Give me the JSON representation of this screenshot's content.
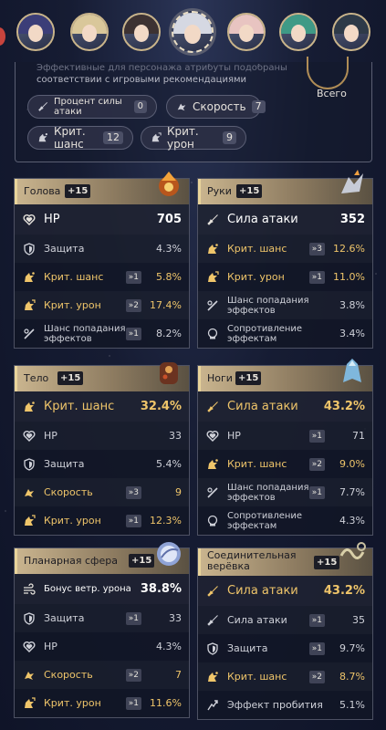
{
  "characters": [
    {
      "name": "char-1",
      "hair": "#3c3e78"
    },
    {
      "name": "char-2",
      "hair": "#d9c79a"
    },
    {
      "name": "char-3",
      "hair": "#3d3232"
    },
    {
      "name": "char-4",
      "hair": "#d5d8e2"
    },
    {
      "name": "char-5",
      "hair": "#e8c4c1"
    },
    {
      "name": "char-6",
      "hair": "#3f9a86"
    },
    {
      "name": "char-7",
      "hair": "#2e3a48"
    }
  ],
  "recommendation": {
    "line1": "Эффективные для персонажа атрибуты подобраны в",
    "line2": "соответствии с игровыми рекомендациями",
    "total_label": "Всего"
  },
  "filters": [
    {
      "label": "Процент силы атаки",
      "count": "0",
      "icon": "attack-icon"
    },
    {
      "label": "Скорость",
      "count": "7",
      "icon": "speed-icon"
    },
    {
      "label": "Крит. шанс",
      "count": "12",
      "icon": "crit-rate-icon"
    },
    {
      "label": "Крит. урон",
      "count": "9",
      "icon": "crit-dmg-icon"
    }
  ],
  "relics": [
    {
      "slot": "Голова",
      "level": "+15",
      "main": {
        "label": "HP",
        "value": "705",
        "icon": "hp-icon"
      },
      "subs": [
        {
          "label": "Защита",
          "roll": "",
          "value": "4.3%",
          "gold": false,
          "icon": "def-icon"
        },
        {
          "label": "Крит. шанс",
          "roll": "»1",
          "value": "5.8%",
          "gold": true,
          "icon": "crit-rate-icon"
        },
        {
          "label": "Крит. урон",
          "roll": "»2",
          "value": "17.4%",
          "gold": true,
          "icon": "crit-dmg-icon"
        },
        {
          "label": "Шанс попадания эффектов",
          "roll": "»1",
          "value": "8.2%",
          "gold": false,
          "icon": "effect-hit-icon"
        }
      ]
    },
    {
      "slot": "Руки",
      "level": "+15",
      "main": {
        "label": "Сила атаки",
        "value": "352",
        "icon": "attack-icon"
      },
      "subs": [
        {
          "label": "Крит. шанс",
          "roll": "»3",
          "value": "12.6%",
          "gold": true,
          "icon": "crit-rate-icon"
        },
        {
          "label": "Крит. урон",
          "roll": "»1",
          "value": "11.0%",
          "gold": true,
          "icon": "crit-dmg-icon"
        },
        {
          "label": "Шанс попадания эффектов",
          "roll": "",
          "value": "3.8%",
          "gold": false,
          "icon": "effect-hit-icon"
        },
        {
          "label": "Сопротивление эффектам",
          "roll": "",
          "value": "3.4%",
          "gold": false,
          "icon": "effect-res-icon"
        }
      ]
    },
    {
      "slot": "Тело",
      "level": "+15",
      "main": {
        "label": "Крит. шанс",
        "value": "32.4%",
        "icon": "crit-rate-icon",
        "gold": true
      },
      "subs": [
        {
          "label": "HP",
          "roll": "",
          "value": "33",
          "gold": false,
          "icon": "hp-icon"
        },
        {
          "label": "Защита",
          "roll": "",
          "value": "5.4%",
          "gold": false,
          "icon": "def-icon"
        },
        {
          "label": "Скорость",
          "roll": "»3",
          "value": "9",
          "gold": true,
          "icon": "speed-icon"
        },
        {
          "label": "Крит. урон",
          "roll": "»1",
          "value": "12.3%",
          "gold": true,
          "icon": "crit-dmg-icon"
        }
      ]
    },
    {
      "slot": "Ноги",
      "level": "+15",
      "main": {
        "label": "Сила атаки",
        "value": "43.2%",
        "icon": "attack-icon",
        "gold": true
      },
      "subs": [
        {
          "label": "HP",
          "roll": "»1",
          "value": "71",
          "gold": false,
          "icon": "hp-icon"
        },
        {
          "label": "Крит. шанс",
          "roll": "»2",
          "value": "9.0%",
          "gold": true,
          "icon": "crit-rate-icon"
        },
        {
          "label": "Шанс попадания эффектов",
          "roll": "»1",
          "value": "7.7%",
          "gold": false,
          "icon": "effect-hit-icon"
        },
        {
          "label": "Сопротивление эффектам",
          "roll": "",
          "value": "4.3%",
          "gold": false,
          "icon": "effect-res-icon"
        }
      ]
    },
    {
      "slot": "Планарная сфера",
      "level": "+15",
      "main": {
        "label": "Бонус ветр. урона",
        "value": "38.8%",
        "icon": "wind-icon",
        "small": true
      },
      "subs": [
        {
          "label": "Защита",
          "roll": "»1",
          "value": "33",
          "gold": false,
          "icon": "def-icon"
        },
        {
          "label": "HP",
          "roll": "",
          "value": "4.3%",
          "gold": false,
          "icon": "hp-icon"
        },
        {
          "label": "Скорость",
          "roll": "»2",
          "value": "7",
          "gold": true,
          "icon": "speed-icon"
        },
        {
          "label": "Крит. урон",
          "roll": "»1",
          "value": "11.6%",
          "gold": true,
          "icon": "crit-dmg-icon"
        }
      ]
    },
    {
      "slot": "Соединительная верёвка",
      "level": "+15",
      "main": {
        "label": "Сила атаки",
        "value": "43.2%",
        "icon": "attack-icon",
        "gold": true
      },
      "subs": [
        {
          "label": "Сила атаки",
          "roll": "»1",
          "value": "35",
          "gold": false,
          "icon": "attack-icon"
        },
        {
          "label": "Защита",
          "roll": "»1",
          "value": "9.7%",
          "gold": false,
          "icon": "def-icon"
        },
        {
          "label": "Крит. шанс",
          "roll": "»2",
          "value": "8.7%",
          "gold": true,
          "icon": "crit-rate-icon"
        },
        {
          "label": "Эффект пробития",
          "roll": "",
          "value": "5.1%",
          "gold": false,
          "icon": "break-icon"
        }
      ]
    }
  ],
  "colors": {
    "gold": "#efc56a",
    "header_light": "#c9b48e",
    "panel_bg": "#12162a"
  }
}
